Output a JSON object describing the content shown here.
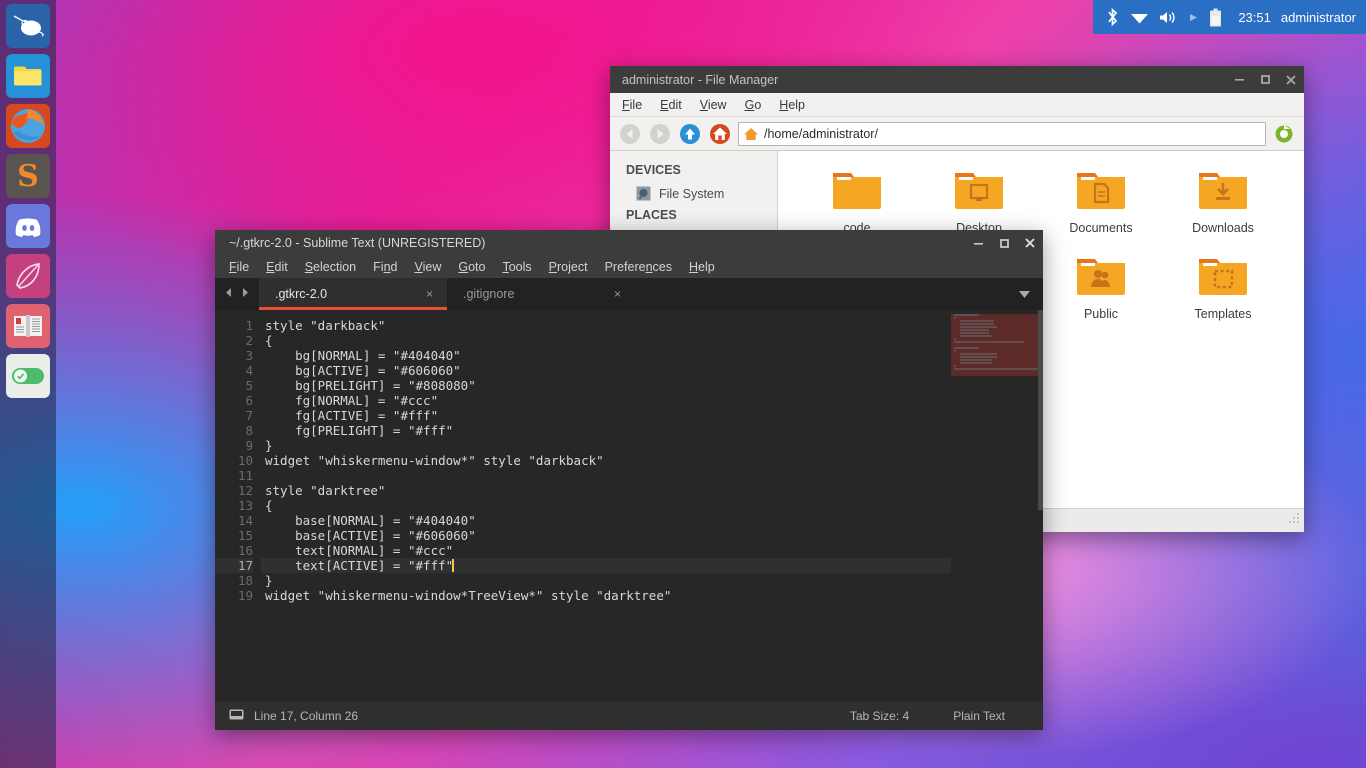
{
  "top_panel": {
    "icons": [
      "bluetooth-icon",
      "wifi-icon",
      "volume-icon",
      "media-play-icon",
      "battery-icon"
    ],
    "clock": "23:51",
    "user": "administrator"
  },
  "dock": {
    "items": [
      {
        "name": "whisker-menu",
        "icon": "mouse-icon",
        "running": false
      },
      {
        "name": "file-manager",
        "icon": "folder-icon",
        "running": true
      },
      {
        "name": "firefox",
        "icon": "firefox-icon",
        "running": true
      },
      {
        "name": "sublime-text",
        "icon": "sublime-s-icon",
        "running": true
      },
      {
        "name": "discord",
        "icon": "discord-icon",
        "running": false
      },
      {
        "name": "feather-editor",
        "icon": "feather-icon",
        "running": false
      },
      {
        "name": "dictionary",
        "icon": "book-icon",
        "running": false
      },
      {
        "name": "settings",
        "icon": "toggle-switch-icon",
        "running": false
      }
    ]
  },
  "file_manager": {
    "title": "administrator - File Manager",
    "menu": [
      "File",
      "Edit",
      "View",
      "Go",
      "Help"
    ],
    "toolbar": {
      "back": "back-arrow-icon",
      "forward": "forward-arrow-icon",
      "up": "up-arrow-icon",
      "home": "home-icon",
      "reload": "reload-icon"
    },
    "path": "/home/administrator/",
    "sidebar": {
      "devices_label": "DEVICES",
      "devices": [
        "File System"
      ],
      "places_label": "PLACES"
    },
    "files": [
      {
        "label": "code",
        "icon": "folder-plain-icon"
      },
      {
        "label": "Desktop",
        "icon": "folder-desktop-icon"
      },
      {
        "label": "Documents",
        "icon": "folder-documents-icon"
      },
      {
        "label": "Downloads",
        "icon": "folder-downloads-icon"
      },
      {
        "label": "Public",
        "icon": "folder-public-icon"
      },
      {
        "label": "Templates",
        "icon": "folder-templates-icon"
      }
    ],
    "window_buttons": [
      "minimize",
      "maximize",
      "close"
    ]
  },
  "sublime": {
    "title": "~/.gtkrc-2.0 - Sublime Text (UNREGISTERED)",
    "menu": [
      "File",
      "Edit",
      "Selection",
      "Find",
      "View",
      "Goto",
      "Tools",
      "Project",
      "Preferences",
      "Help"
    ],
    "tabs": [
      {
        "label": ".gtkrc-2.0",
        "active": true,
        "close": "×"
      },
      {
        "label": ".gitignore",
        "active": false,
        "close": "×"
      }
    ],
    "accent_color": "#e84f33",
    "cursor_line": 17,
    "lines": [
      "style \"darkback\"",
      "{",
      "    bg[NORMAL] = \"#404040\"",
      "    bg[ACTIVE] = \"#606060\"",
      "    bg[PRELIGHT] = \"#808080\"",
      "    fg[NORMAL] = \"#ccc\"",
      "    fg[ACTIVE] = \"#fff\"",
      "    fg[PRELIGHT] = \"#fff\"",
      "}",
      "widget \"whiskermenu-window*\" style \"darkback\"",
      "",
      "style \"darktree\"",
      "{",
      "    base[NORMAL] = \"#404040\"",
      "    base[ACTIVE] = \"#606060\"",
      "    text[NORMAL] = \"#ccc\"",
      "    text[ACTIVE] = \"#fff\"",
      "}",
      "widget \"whiskermenu-window*TreeView*\" style \"darktree\""
    ],
    "statusbar": {
      "position": "Line 17, Column 26",
      "tab_size": "Tab Size: 4",
      "syntax": "Plain Text"
    },
    "window_buttons": [
      "minimize",
      "maximize",
      "close"
    ]
  }
}
